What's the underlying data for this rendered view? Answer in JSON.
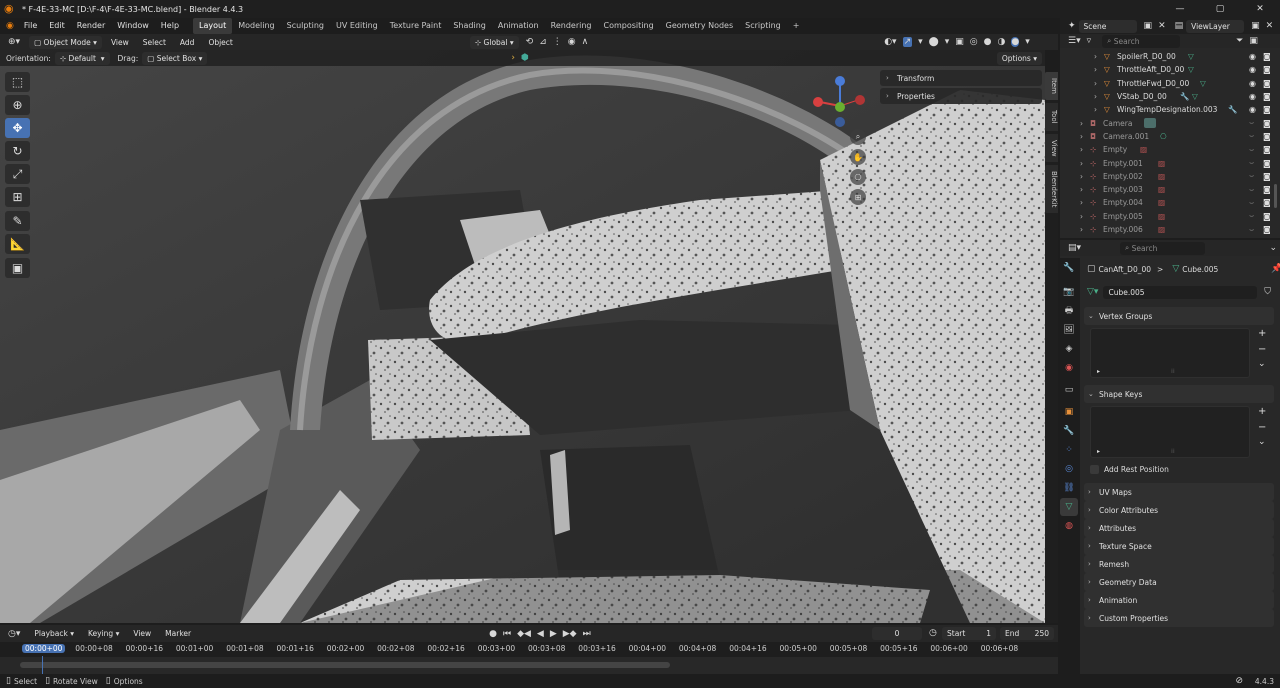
{
  "window": {
    "title": "* F-4E-33-MC [D:\\F-4\\F-4E-33-MC.blend] - Blender 4.4.3",
    "minimize": "—",
    "maximize": "▢",
    "close": "✕"
  },
  "menu": [
    "File",
    "Edit",
    "Render",
    "Window",
    "Help"
  ],
  "workspaces": [
    "Layout",
    "Modeling",
    "Sculpting",
    "UV Editing",
    "Texture Paint",
    "Shading",
    "Animation",
    "Rendering",
    "Compositing",
    "Geometry Nodes",
    "Scripting"
  ],
  "workspace_add": "+",
  "viewport_header": {
    "mode": "Object Mode",
    "menus": [
      "View",
      "Select",
      "Add",
      "Object"
    ],
    "transform": "Global"
  },
  "tool_header": {
    "orientation_label": "Orientation:",
    "orientation": "Default",
    "drag_label": "Drag:",
    "drag": "Select Box",
    "options": "Options"
  },
  "npanel": {
    "transform": "Transform",
    "properties": "Properties"
  },
  "side_tabs": [
    "Item",
    "Tool",
    "View",
    "BlenderKit"
  ],
  "outliner_top": {
    "scene": "Scene",
    "viewlayer": "ViewLayer"
  },
  "outliner_search": "Search",
  "outliner_items": [
    {
      "label": "SpoilerR_D0_00",
      "type": "mesh"
    },
    {
      "label": "ThrottleAft_D0_00",
      "type": "mesh"
    },
    {
      "label": "ThrottleFwd_D0_00",
      "type": "mesh"
    },
    {
      "label": "VStab_D0_00",
      "type": "mesh"
    },
    {
      "label": "WingTempDesignation.003",
      "type": "mesh"
    },
    {
      "label": "Camera",
      "type": "camera"
    },
    {
      "label": "Camera.001",
      "type": "camera"
    },
    {
      "label": "Empty",
      "type": "empty"
    },
    {
      "label": "Empty.001",
      "type": "empty"
    },
    {
      "label": "Empty.002",
      "type": "empty"
    },
    {
      "label": "Empty.003",
      "type": "empty"
    },
    {
      "label": "Empty.004",
      "type": "empty"
    },
    {
      "label": "Empty.005",
      "type": "empty"
    },
    {
      "label": "Empty.006",
      "type": "empty"
    }
  ],
  "props": {
    "search": "Search",
    "breadcrumb_object": "CanAft_D0_00",
    "breadcrumb_sep": ">",
    "breadcrumb_data": "Cube.005",
    "data_name": "Cube.005",
    "panels": [
      "Vertex Groups",
      "Shape Keys",
      "UV Maps",
      "Color Attributes",
      "Attributes",
      "Texture Space",
      "Remesh",
      "Geometry Data",
      "Animation",
      "Custom Properties"
    ],
    "add_rest_position": "Add Rest Position"
  },
  "timeline": {
    "menus": [
      "Playback",
      "Keying",
      "View",
      "Marker"
    ],
    "current_frame": "0",
    "start_label": "Start",
    "start": "1",
    "end_label": "End",
    "end": "250",
    "ticks": [
      "00:00+00",
      "00:00+08",
      "00:00+16",
      "00:01+00",
      "00:01+08",
      "00:01+16",
      "00:02+00",
      "00:02+08",
      "00:02+16",
      "00:03+00",
      "00:03+08",
      "00:03+16",
      "00:04+00",
      "00:04+08",
      "00:04+16",
      "00:05+00",
      "00:05+08",
      "00:05+16",
      "00:06+00",
      "00:06+08"
    ]
  },
  "status": {
    "select": "Select",
    "rotate": "Rotate View",
    "options": "Options",
    "version": "4.4.3"
  }
}
